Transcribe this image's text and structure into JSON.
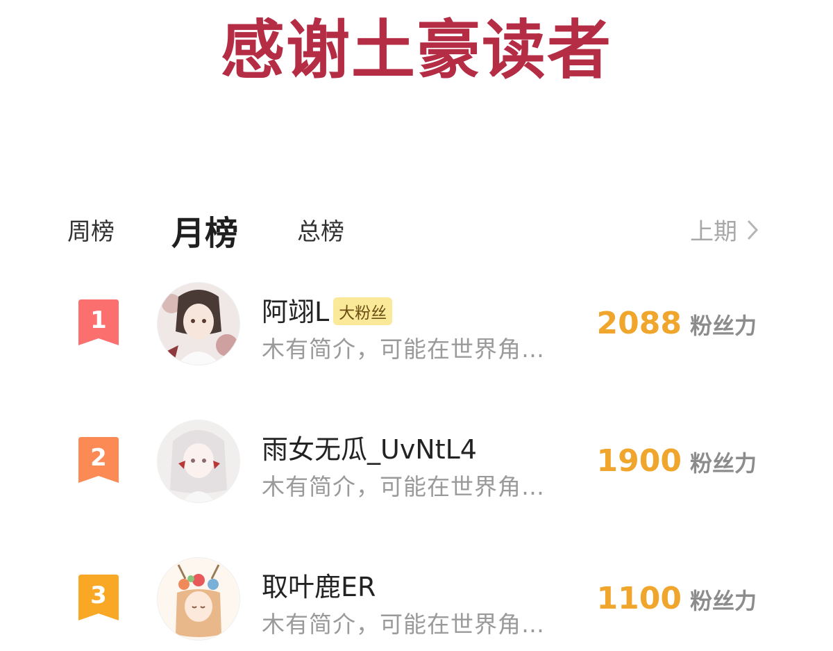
{
  "banner": {
    "title": "感谢土豪读者",
    "color": "#b52d45"
  },
  "tabs": [
    {
      "label": "周榜",
      "active": false
    },
    {
      "label": "月榜",
      "active": true
    },
    {
      "label": "总榜",
      "active": false
    }
  ],
  "prev_period": {
    "label": "上期",
    "icon": "chevron-right-icon"
  },
  "ranking": [
    {
      "rank": "1",
      "badge_color": "#fb6f6f",
      "name": "阿翊L",
      "fan_badge": "大粉丝",
      "bio": "木有简介，可能在世界角…",
      "score": "2088",
      "unit": "粉丝力"
    },
    {
      "rank": "2",
      "badge_color": "#fb8a55",
      "name": "雨女无瓜_UvNtL4",
      "bio": "木有简介，可能在世界角…",
      "score": "1900",
      "unit": "粉丝力"
    },
    {
      "rank": "3",
      "badge_color": "#f9a826",
      "name": "取叶鹿ER",
      "bio": "木有简介，可能在世界角…",
      "score": "1100",
      "unit": "粉丝力"
    }
  ],
  "colors": {
    "score": "#f0a52d",
    "fan_badge_bg": "#fbe99a"
  }
}
